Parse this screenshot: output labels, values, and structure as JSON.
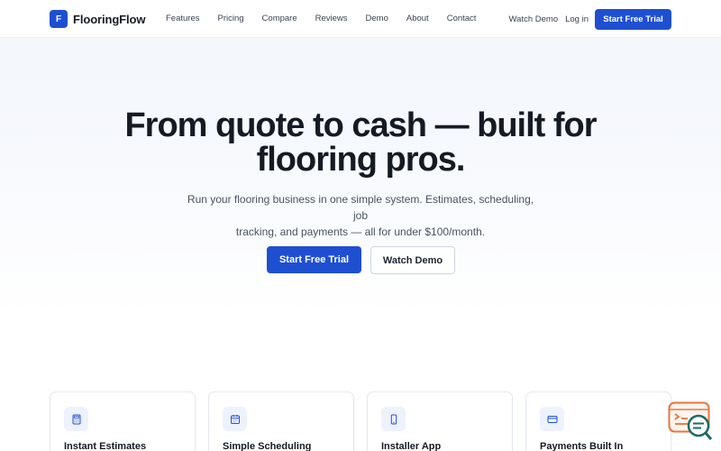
{
  "brand": {
    "logo_letter": "F",
    "name": "FlooringFlow",
    "color": "#1f4fd1"
  },
  "nav": {
    "links": [
      "Features",
      "Pricing",
      "Compare",
      "Reviews",
      "Demo",
      "About",
      "Contact"
    ],
    "watch_demo": "Watch Demo",
    "login": "Log in",
    "cta": "Start Free Trial"
  },
  "hero": {
    "title_line1": "From quote to cash — built for",
    "title_line2": "flooring pros.",
    "subtitle_line1": "Run your flooring business in one simple system. Estimates, scheduling, job",
    "subtitle_line2": "tracking, and payments — all for under $100/month.",
    "primary_cta": "Start Free Trial",
    "secondary_cta": "Watch Demo"
  },
  "features": [
    {
      "icon": "calculator-icon",
      "title": "Instant Estimates"
    },
    {
      "icon": "calendar-icon",
      "title": "Simple Scheduling"
    },
    {
      "icon": "phone-icon",
      "title": "Installer App"
    },
    {
      "icon": "credit-card-icon",
      "title": "Payments Built In"
    }
  ],
  "chat_widget": {
    "icon": "chat-search-icon",
    "color": "#e8743b"
  }
}
